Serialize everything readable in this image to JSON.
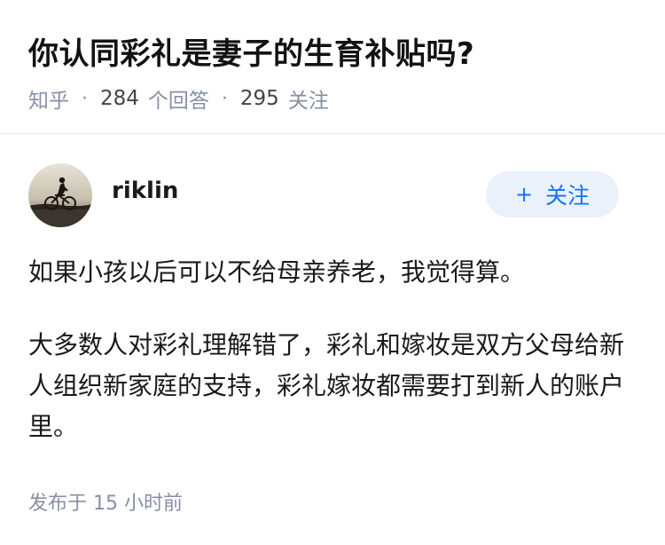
{
  "question": {
    "title": "你认同彩礼是妻子的生育补贴吗?",
    "source": "知乎",
    "separator": "·",
    "answer_count": "284",
    "answer_label": "个回答",
    "follower_count": "295",
    "follower_label": "关注"
  },
  "author": {
    "name": "riklin",
    "avatar_icon": "cyclist-silhouette-avatar",
    "follow_plus": "+",
    "follow_label": "关注"
  },
  "answer": {
    "paragraphs": [
      "如果小孩以后可以不给母亲养老，我觉得算。",
      "大多数人对彩礼理解错了，彩礼和嫁妆是双方父母给新人组织新家庭的支持，彩礼嫁妆都需要打到新人的账户里。"
    ]
  },
  "footer": {
    "published_text": "发布于 15 小时前"
  },
  "colors": {
    "accent_blue": "#1772f6",
    "follow_button_bg": "#eaf1fb",
    "meta_gray": "#8590a6",
    "divider": "#ebebeb"
  }
}
